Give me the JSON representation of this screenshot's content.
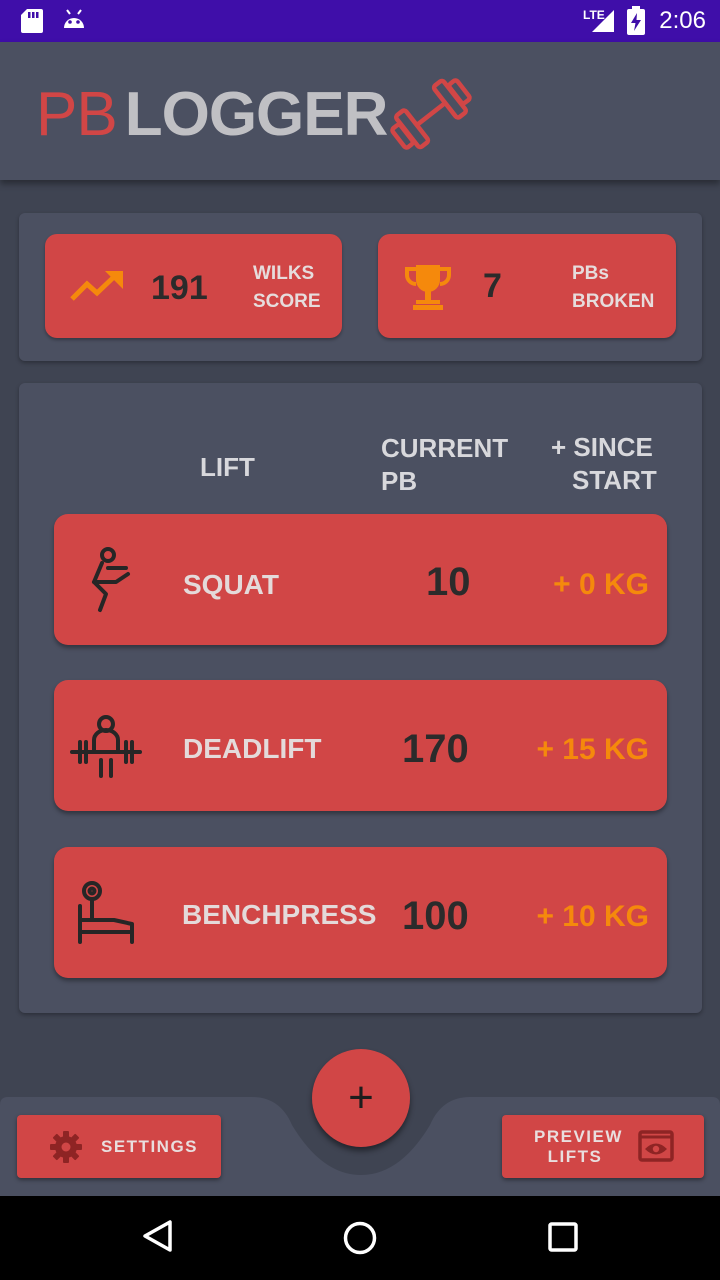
{
  "status_bar": {
    "network": "LTE",
    "time": "2:06",
    "icons": [
      "sd-card-icon",
      "android-icon",
      "lte-signal-icon",
      "battery-charging-icon"
    ]
  },
  "app_bar": {
    "title_prefix": "PB",
    "title_main": "LOGGER",
    "logo_icon": "dumbbell-icon"
  },
  "stats": {
    "wilks": {
      "value": "191",
      "label_line1": "WILKS",
      "label_line2": "SCORE",
      "icon": "trending-up-icon"
    },
    "pbs": {
      "value": "7",
      "label_line1": "PBs",
      "label_line2": "BROKEN",
      "icon": "trophy-icon"
    }
  },
  "table": {
    "headers": {
      "lift": "LIFT",
      "current_pb_line1": "CURRENT",
      "current_pb_line2": "PB",
      "since_start_line1": "+ SINCE",
      "since_start_line2": "START"
    },
    "rows": [
      {
        "name": "SQUAT",
        "pb": "10",
        "gain": "+ 0 KG",
        "icon": "squat-icon"
      },
      {
        "name": "DEADLIFT",
        "pb": "170",
        "gain": "+ 15 KG",
        "icon": "deadlift-icon"
      },
      {
        "name": "BENCHPRESS",
        "pb": "100",
        "gain": "+ 10 KG",
        "icon": "benchpress-icon"
      }
    ]
  },
  "bottom": {
    "settings_label": "SETTINGS",
    "preview_line1": "PREVIEW",
    "preview_line2": "LIFTS",
    "fab_label": "+"
  },
  "colors": {
    "accent": "#d14646",
    "background": "#3f4452",
    "panel": "#4b5061",
    "gain": "#f5890c",
    "status_bar": "#3f0ea9"
  }
}
